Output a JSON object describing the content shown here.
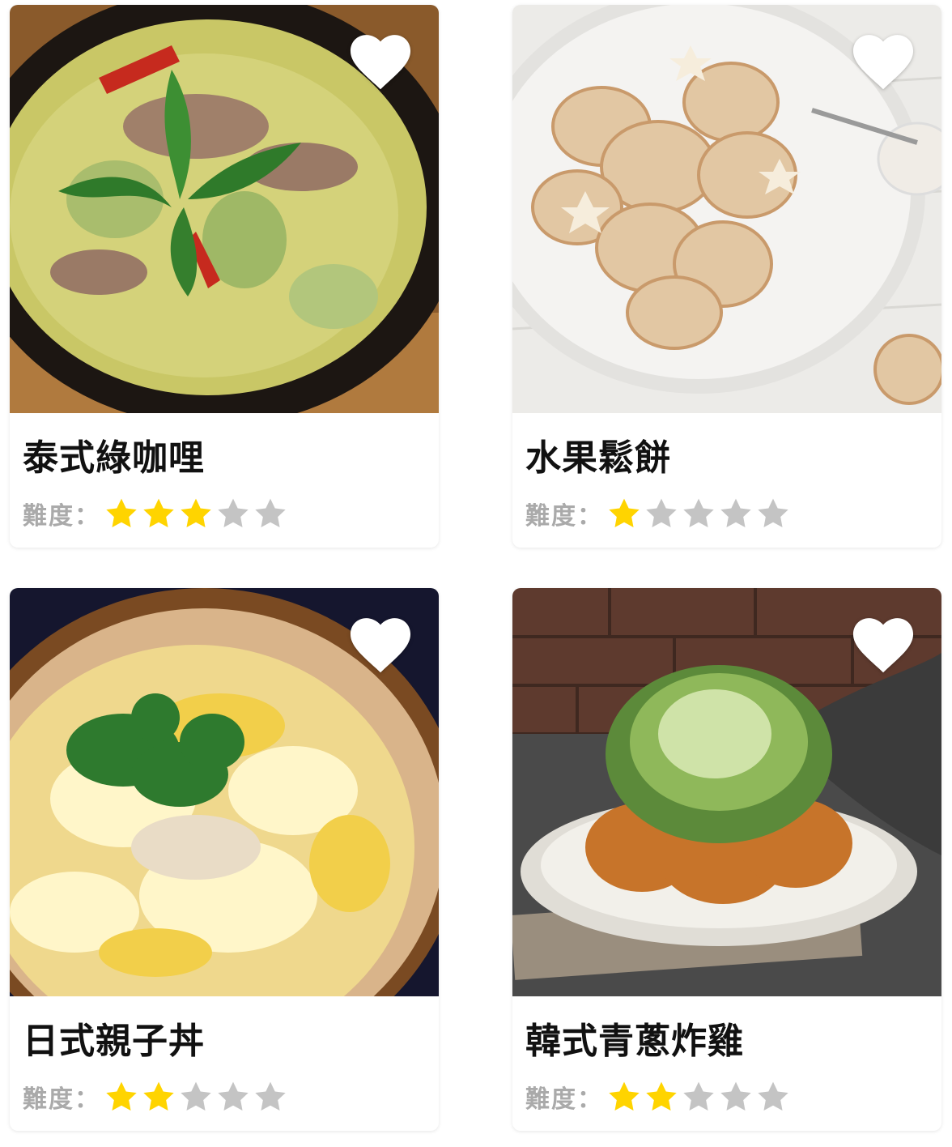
{
  "rating_label": "難度：",
  "colors": {
    "star_filled": "#FFD400",
    "star_empty": "#C4C4C4",
    "heart": "#FFFFFF"
  },
  "recipes": [
    {
      "title": "泰式綠咖哩",
      "difficulty": 3,
      "max_difficulty": 5,
      "favorite_icon": "heart-icon"
    },
    {
      "title": "水果鬆餅",
      "difficulty": 1,
      "max_difficulty": 5,
      "favorite_icon": "heart-icon"
    },
    {
      "title": "日式親子丼",
      "difficulty": 2,
      "max_difficulty": 5,
      "favorite_icon": "heart-icon"
    },
    {
      "title": "韓式青蔥炸雞",
      "difficulty": 2,
      "max_difficulty": 5,
      "favorite_icon": "heart-icon"
    }
  ]
}
